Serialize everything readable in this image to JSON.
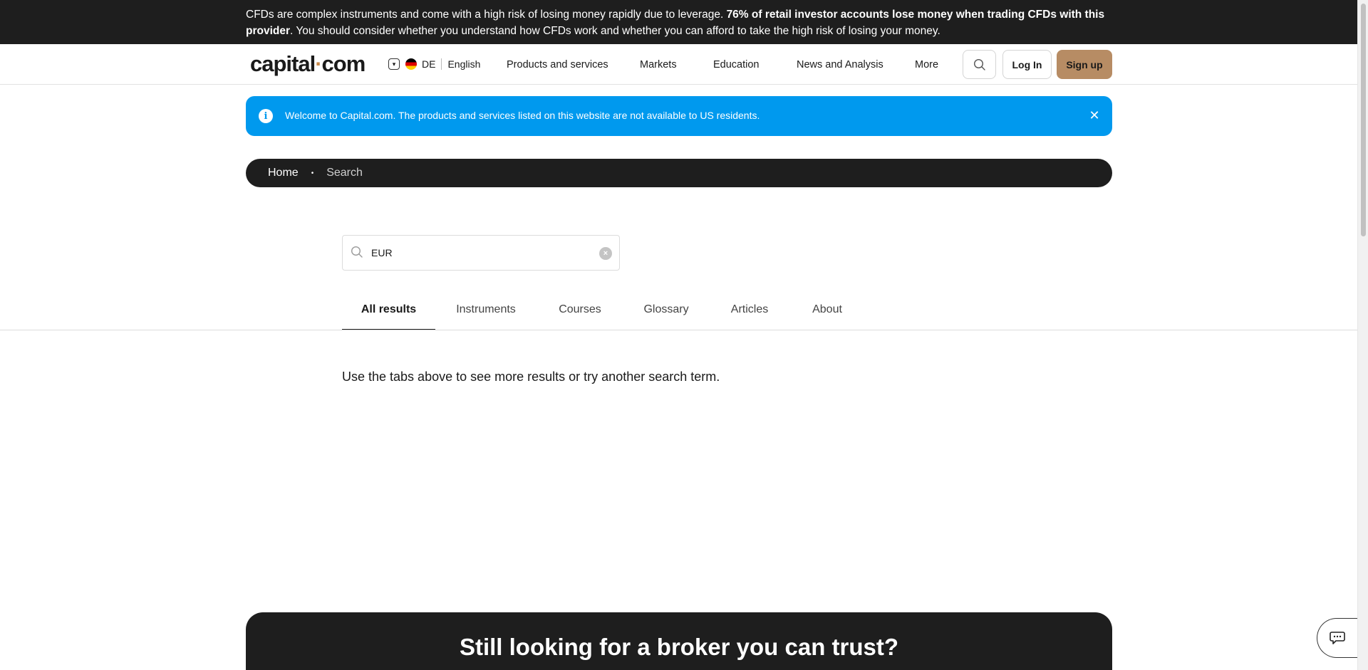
{
  "risk_warning": {
    "text_before": "CFDs are complex instruments and come with a high risk of losing money rapidly due to leverage. ",
    "text_bold": "76% of retail investor accounts lose money when trading CFDs with this provider",
    "text_after": ". You should consider whether you understand how CFDs work and whether you can afford to take the high risk of losing your money."
  },
  "header": {
    "logo_left": "capital",
    "logo_dot": "·",
    "logo_right": "com",
    "region": "DE",
    "language": "English",
    "nav": {
      "products": "Products and services",
      "markets": "Markets",
      "education": "Education",
      "news": "News and Analysis",
      "more": "More"
    },
    "login_label": "Log In",
    "signup_label": "Sign up"
  },
  "info_banner": {
    "icon": "info-icon",
    "text": "Welcome to Capital.com. The products and services listed on this website are not available to US residents.",
    "close_glyph": "✕"
  },
  "breadcrumb": {
    "home": "Home",
    "separator": "•",
    "current": "Search"
  },
  "search": {
    "value": "EUR",
    "clear_glyph": "×"
  },
  "tabs": {
    "all": "All results",
    "instruments": "Instruments",
    "courses": "Courses",
    "glossary": "Glossary",
    "articles": "Articles",
    "about": "About",
    "active": "All results"
  },
  "hint": "Use the tabs above to see more results or try another search term.",
  "cta": {
    "title": "Still looking for a broker you can trust?"
  },
  "colors": {
    "dark": "#1e1e1e",
    "info_blue": "#0099ee",
    "signup": "#b78c64",
    "logo_dot": "#c98a4b"
  }
}
